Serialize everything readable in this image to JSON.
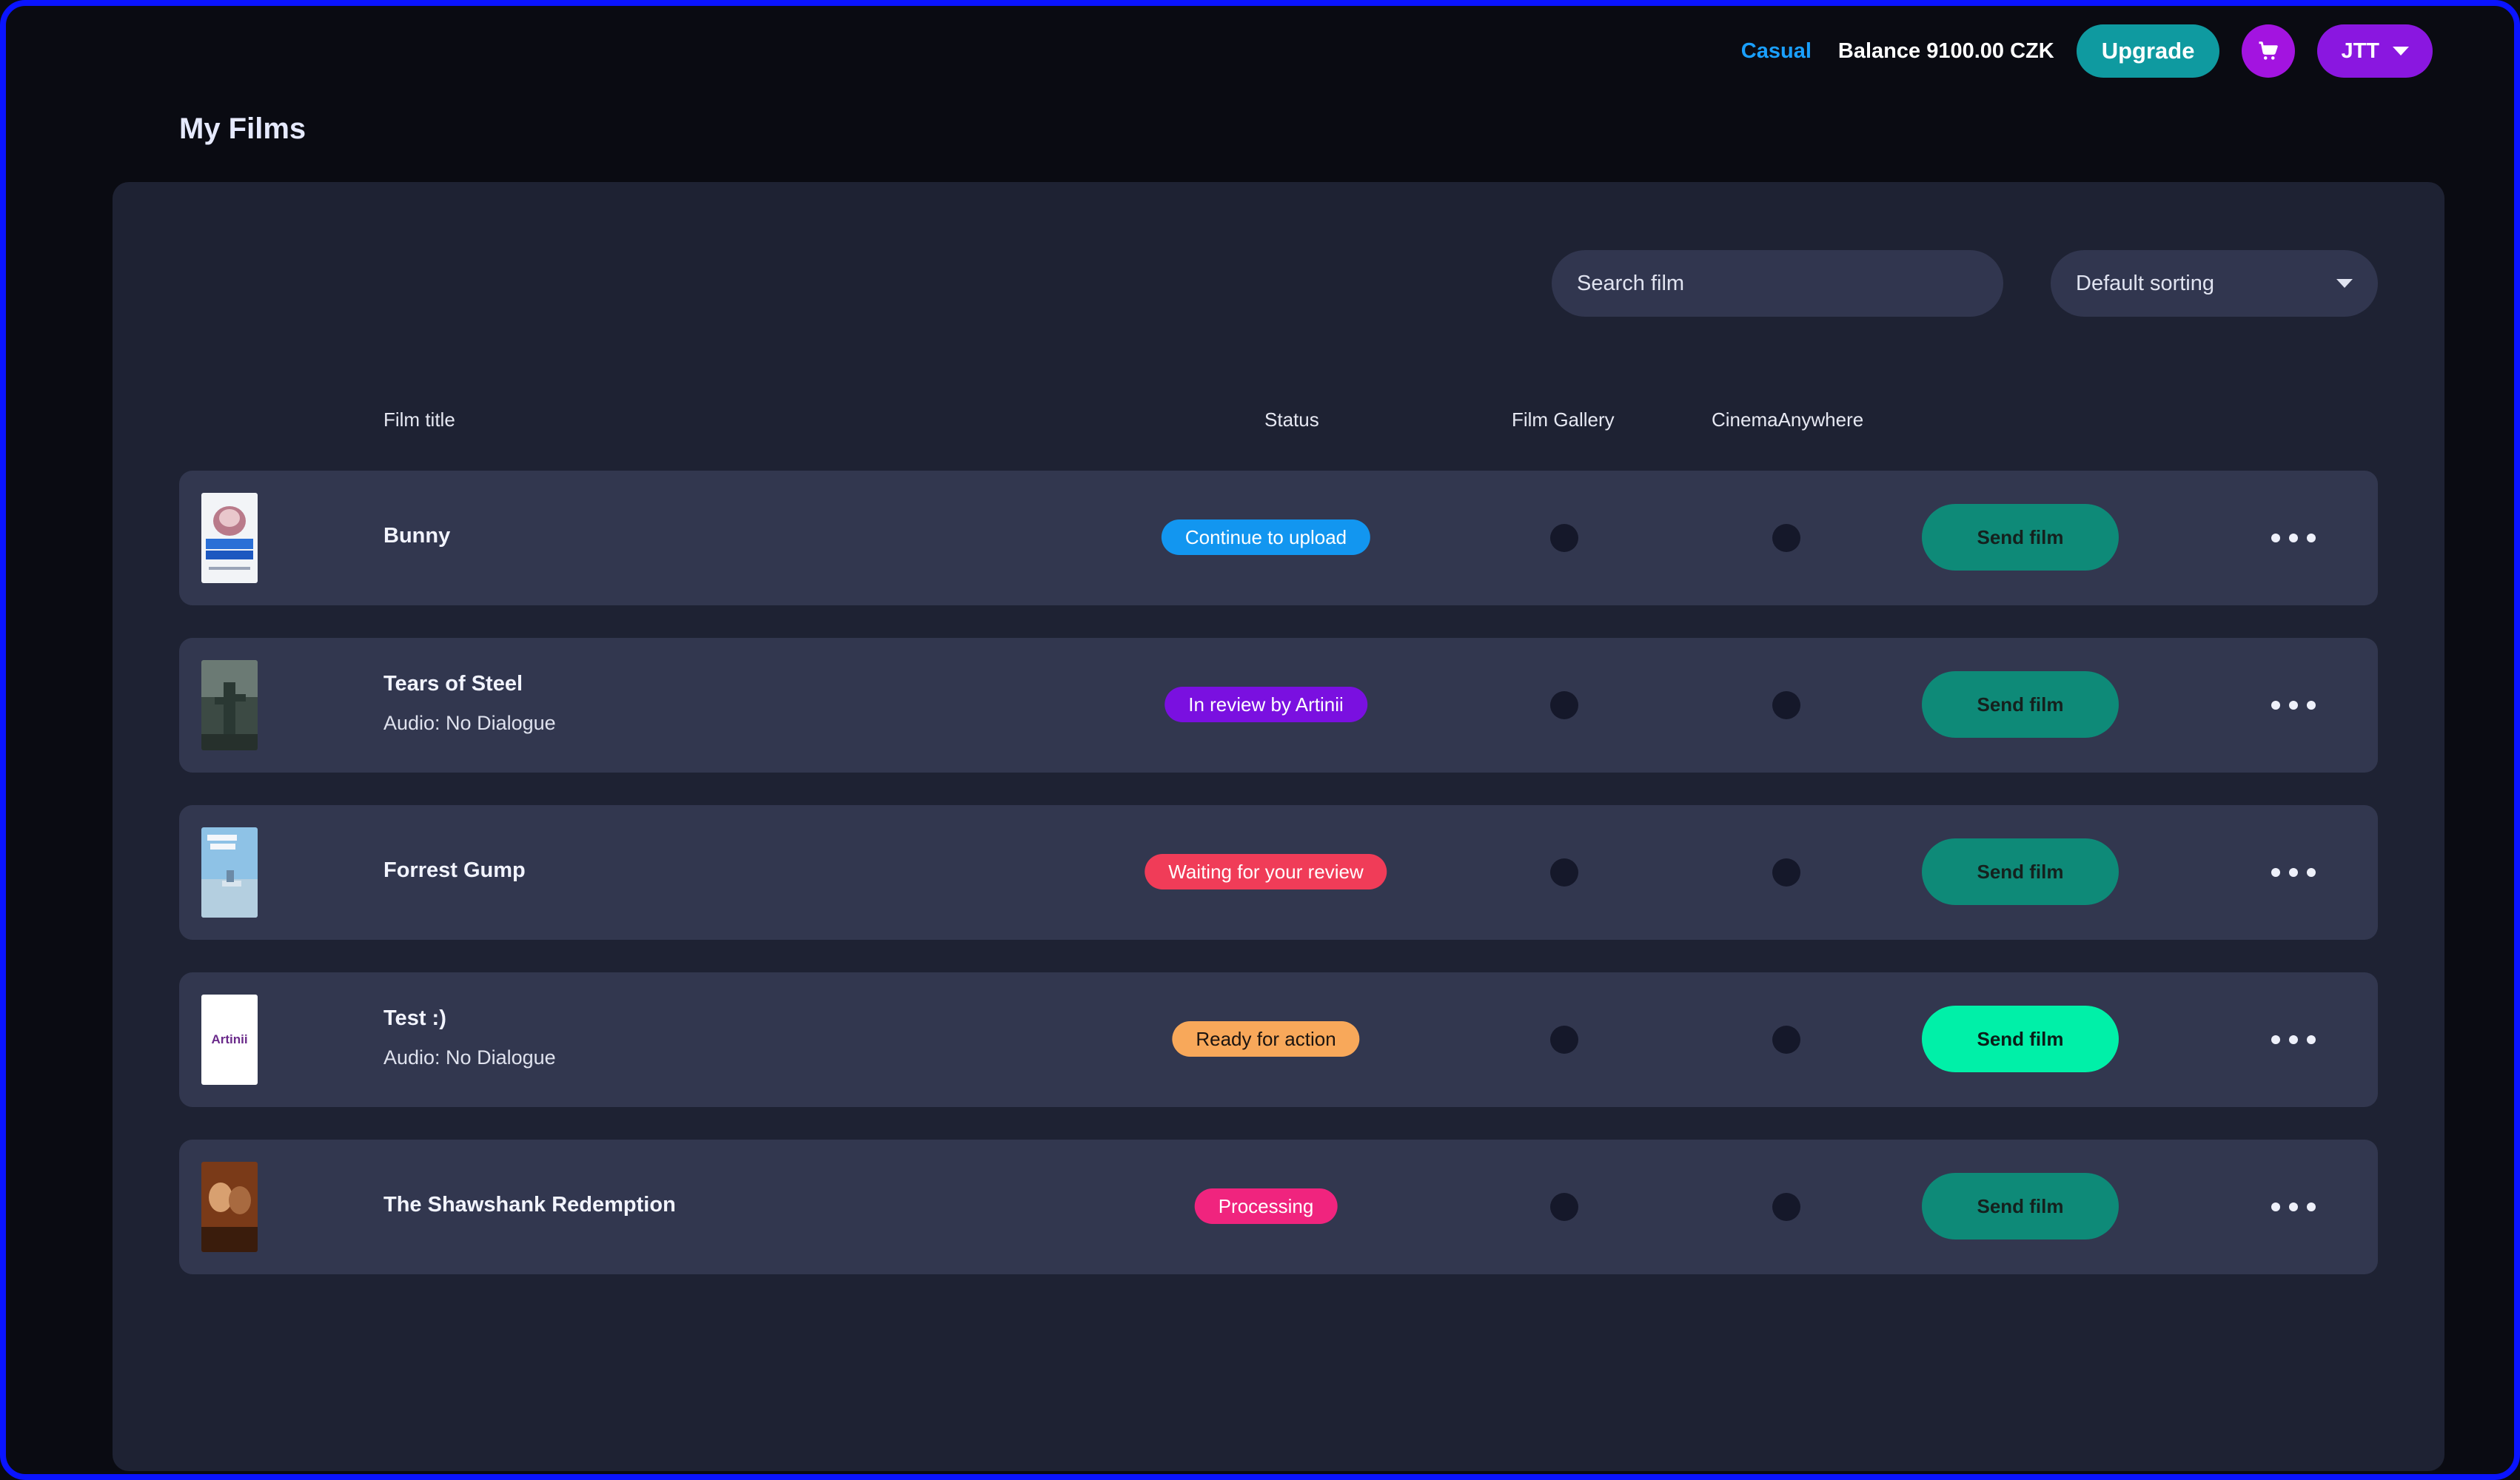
{
  "header": {
    "plan": "Casual",
    "balance": "Balance 9100.00 CZK",
    "upgrade_label": "Upgrade",
    "cart_icon": "cart-icon",
    "user_label": "JTT"
  },
  "page": {
    "title": "My Films"
  },
  "filters": {
    "search_placeholder": "Search film",
    "sort_value": "Default sorting"
  },
  "columns": {
    "title": "Film title",
    "status": "Status",
    "gallery": "Film Gallery",
    "cinema": "CinemaAnywhere"
  },
  "colors": {
    "continue": "#1296f0",
    "review_artinii": "#7a10e0",
    "waiting": "#f03c58",
    "ready": "#f8a85a",
    "processing": "#f0247e",
    "send_inactive": "#0e8a78",
    "send_active": "#00f0a8"
  },
  "films": [
    {
      "title": "Bunny",
      "audio": "",
      "status": "Continue to upload",
      "status_color": "#1296f0",
      "send_label": "Send film"
    },
    {
      "title": "Tears of Steel",
      "audio": "Audio: No Dialogue",
      "status": "In review by Artinii",
      "status_color": "#7a10e0",
      "send_label": "Send film"
    },
    {
      "title": "Forrest Gump",
      "audio": "",
      "status": "Waiting for your review",
      "status_color": "#f03c58",
      "send_label": "Send film"
    },
    {
      "title": "Test :)",
      "audio": "Audio: No Dialogue",
      "status": "Ready for action",
      "status_color": "#f8a85a",
      "send_label": "Send film",
      "thumb_text": "Artinii"
    },
    {
      "title": "The Shawshank Redemption",
      "audio": "",
      "status": "Processing",
      "status_color": "#f0247e",
      "send_label": "Send film"
    }
  ]
}
